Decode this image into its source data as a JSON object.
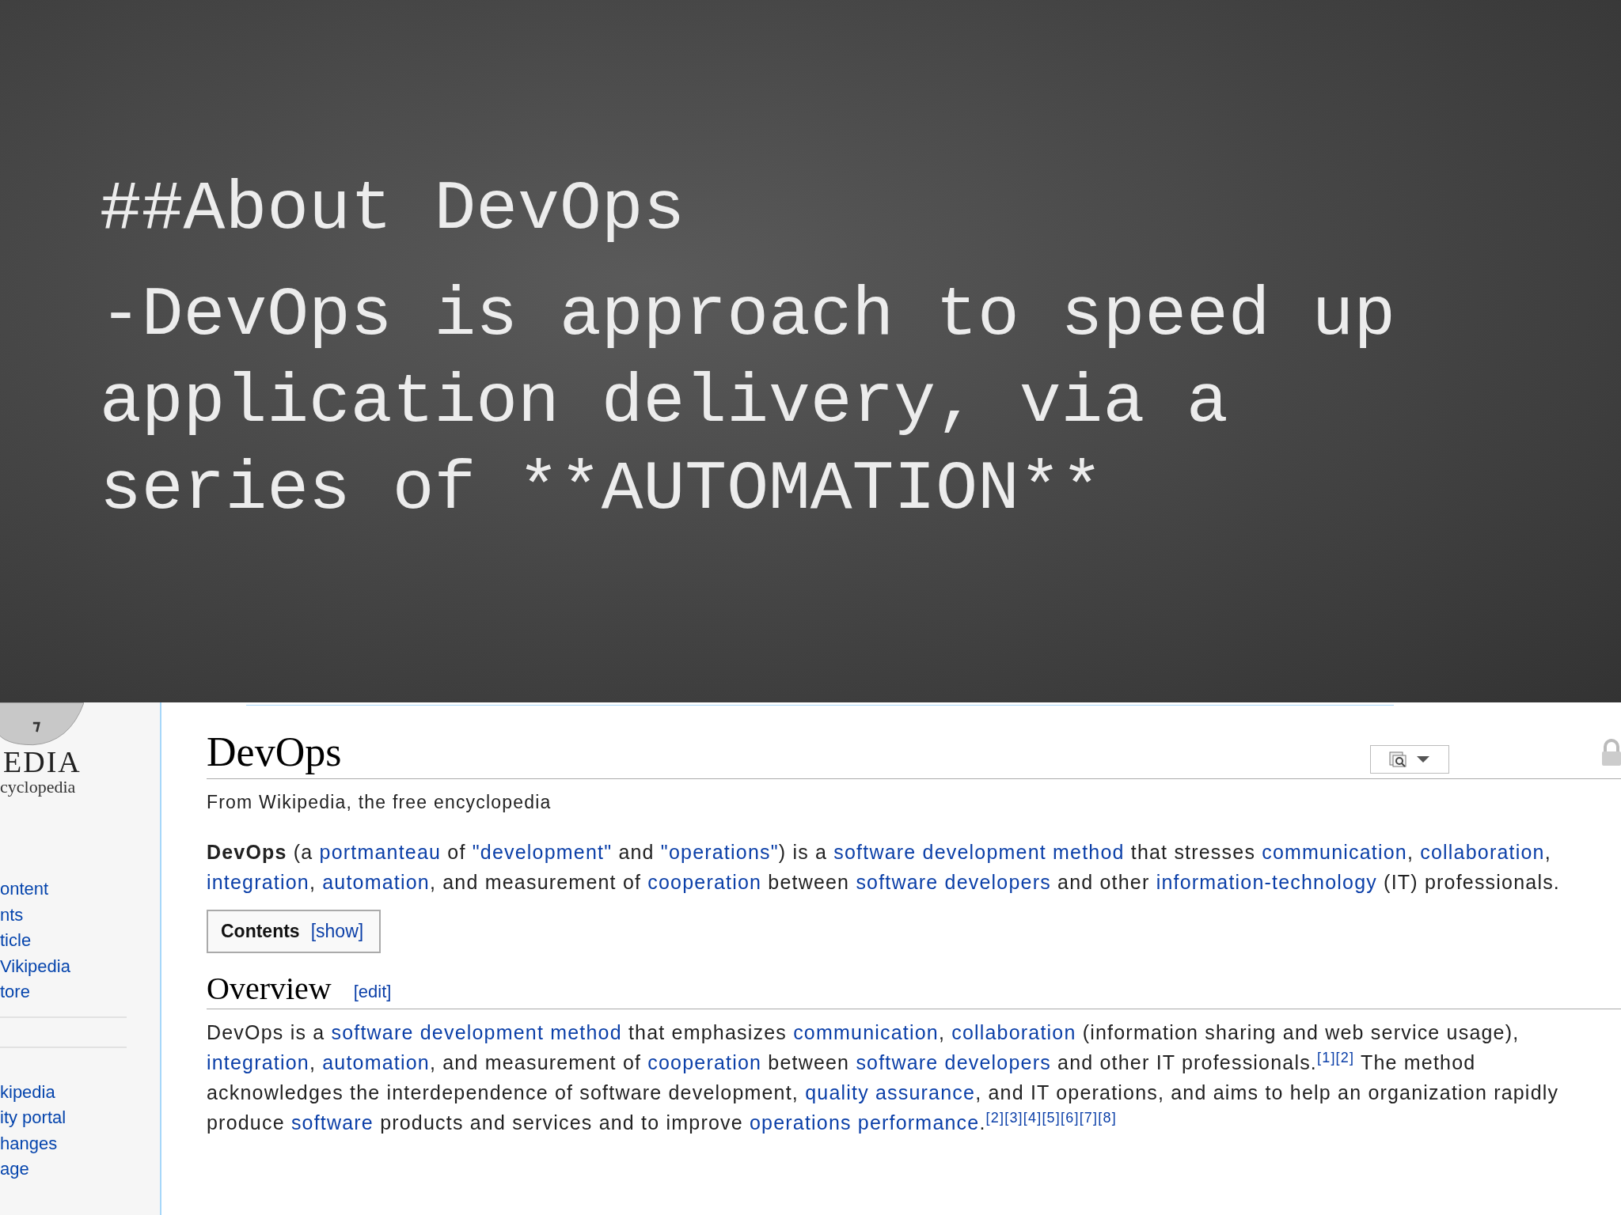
{
  "slide": {
    "heading": "##About DevOps",
    "body": "-DevOps is approach to speed up application delivery, via a series of **AUTOMATION**"
  },
  "wiki": {
    "logo": {
      "wordmark": "EDIA",
      "tagline": "cyclopedia"
    },
    "sidebar_groups": [
      [
        "ontent",
        "nts",
        "ticle",
        "Vikipedia",
        "tore"
      ],
      [
        "kipedia",
        "ity portal",
        "hanges",
        "age"
      ]
    ],
    "title": "DevOps",
    "tagline": "From Wikipedia, the free encyclopedia",
    "intro": [
      {
        "kind": "bold",
        "text": "DevOps"
      },
      {
        "kind": "text",
        "text": " (a "
      },
      {
        "kind": "link",
        "text": "portmanteau"
      },
      {
        "kind": "text",
        "text": " of "
      },
      {
        "kind": "link",
        "text": "\"development\""
      },
      {
        "kind": "text",
        "text": " and "
      },
      {
        "kind": "link",
        "text": "\"operations\""
      },
      {
        "kind": "text",
        "text": ") is a "
      },
      {
        "kind": "link",
        "text": "software development method"
      },
      {
        "kind": "text",
        "text": " that stresses "
      },
      {
        "kind": "link",
        "text": "communication"
      },
      {
        "kind": "text",
        "text": ", "
      },
      {
        "kind": "link",
        "text": "collaboration"
      },
      {
        "kind": "text",
        "text": ", "
      },
      {
        "kind": "link",
        "text": "integration"
      },
      {
        "kind": "text",
        "text": ", "
      },
      {
        "kind": "link",
        "text": "automation"
      },
      {
        "kind": "text",
        "text": ", and measurement of "
      },
      {
        "kind": "link",
        "text": "cooperation"
      },
      {
        "kind": "text",
        "text": " between "
      },
      {
        "kind": "link",
        "text": "software developers"
      },
      {
        "kind": "text",
        "text": " and other "
      },
      {
        "kind": "link",
        "text": "information-technology"
      },
      {
        "kind": "text",
        "text": " (IT) professionals."
      }
    ],
    "toc": {
      "title": "Contents",
      "toggle": "[show]"
    },
    "sections": [
      {
        "heading": "Overview",
        "edit": "[edit]",
        "paragraph": [
          {
            "kind": "text",
            "text": "DevOps is a "
          },
          {
            "kind": "link",
            "text": "software development method"
          },
          {
            "kind": "text",
            "text": " that emphasizes "
          },
          {
            "kind": "link",
            "text": "communication"
          },
          {
            "kind": "text",
            "text": ", "
          },
          {
            "kind": "link",
            "text": "collaboration"
          },
          {
            "kind": "text",
            "text": " (information sharing and web service usage), "
          },
          {
            "kind": "link",
            "text": "integration"
          },
          {
            "kind": "text",
            "text": ", "
          },
          {
            "kind": "link",
            "text": "automation"
          },
          {
            "kind": "text",
            "text": ", and measurement of "
          },
          {
            "kind": "link",
            "text": "cooperation"
          },
          {
            "kind": "text",
            "text": " between "
          },
          {
            "kind": "link",
            "text": "software developers"
          },
          {
            "kind": "text",
            "text": " and other IT professionals."
          },
          {
            "kind": "ref",
            "text": "[1][2]"
          },
          {
            "kind": "text",
            "text": " The method acknowledges the interdependence of software development, "
          },
          {
            "kind": "link",
            "text": "quality assurance"
          },
          {
            "kind": "text",
            "text": ", and IT operations, and aims to help an organization rapidly produce "
          },
          {
            "kind": "link",
            "text": "software"
          },
          {
            "kind": "text",
            "text": " products and services and to improve "
          },
          {
            "kind": "link",
            "text": "operations performance"
          },
          {
            "kind": "text",
            "text": "."
          },
          {
            "kind": "ref",
            "text": "[2][3][4][5][6][7][8]"
          }
        ]
      }
    ]
  }
}
